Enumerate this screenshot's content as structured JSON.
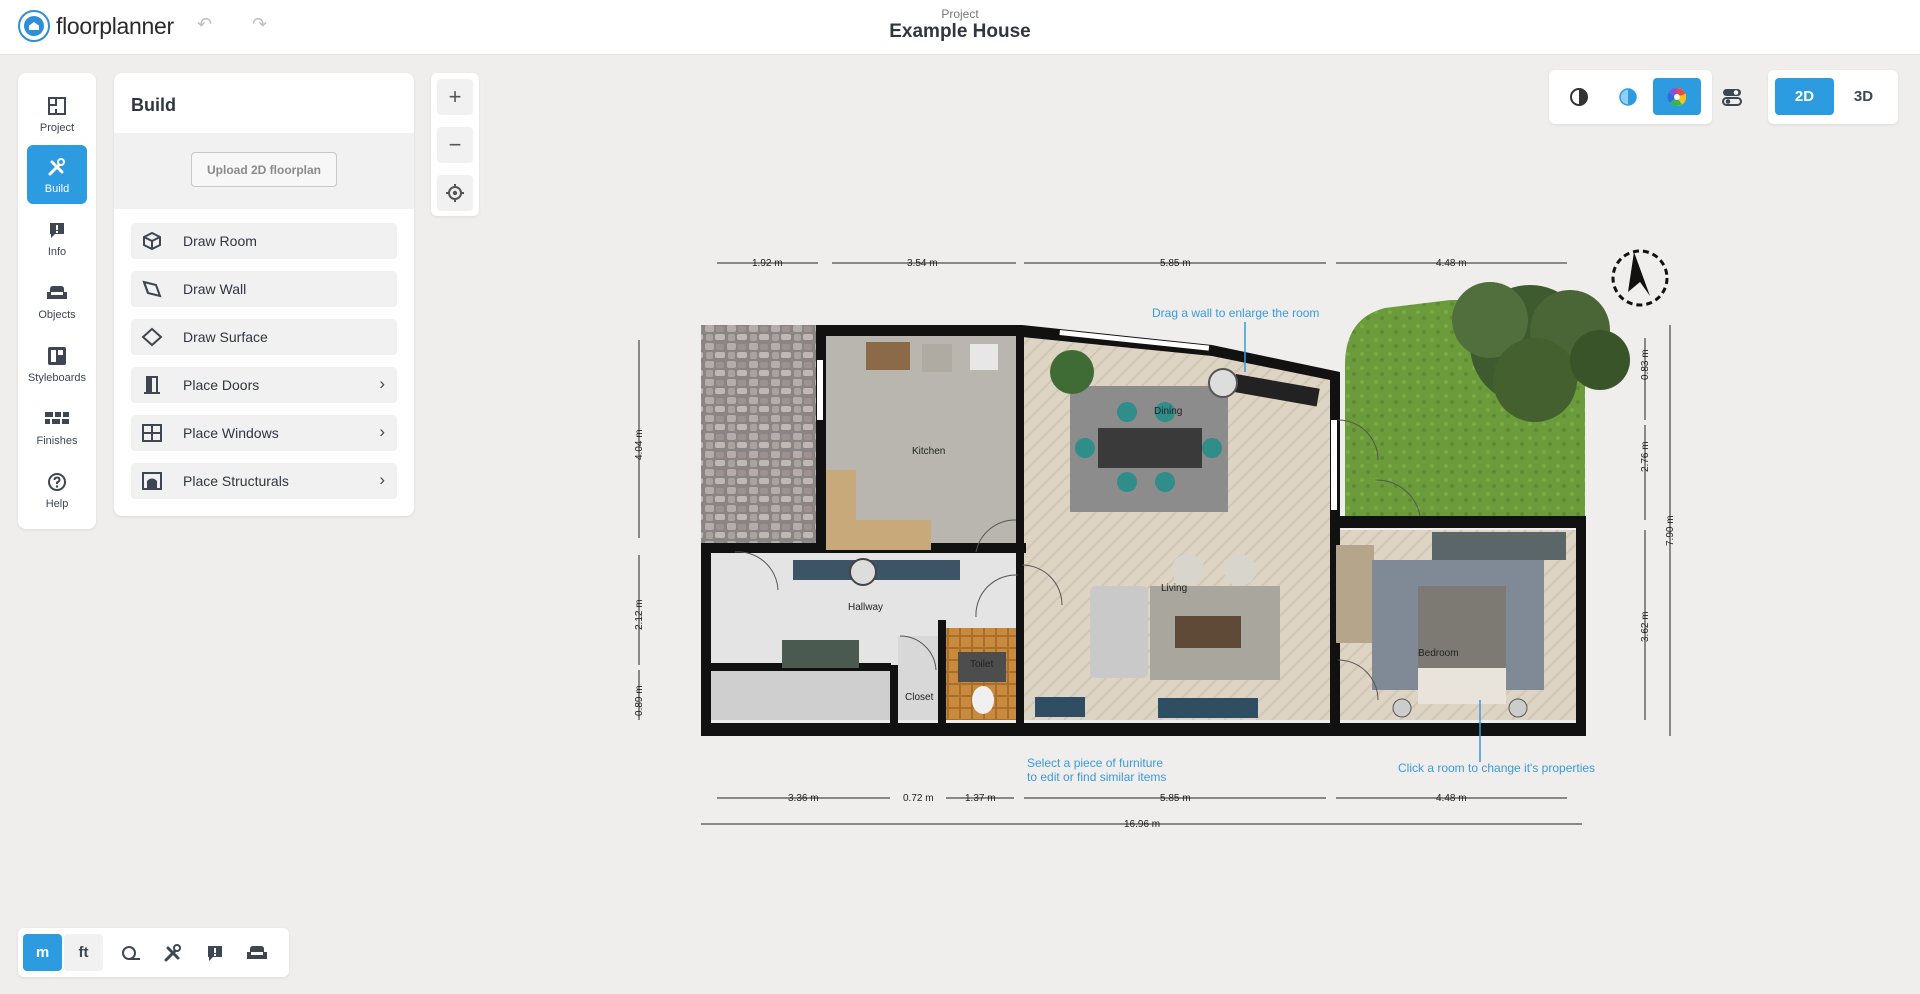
{
  "app": {
    "logo_text": "floorplanner"
  },
  "header": {
    "project_label": "Project",
    "project_title": "Example House"
  },
  "rail": [
    {
      "label": "Project",
      "icon": "floorplan-icon"
    },
    {
      "label": "Build",
      "icon": "tools-icon"
    },
    {
      "label": "Info",
      "icon": "info-bubble-icon"
    },
    {
      "label": "Objects",
      "icon": "sofa-icon"
    },
    {
      "label": "Styleboards",
      "icon": "styleboard-icon"
    },
    {
      "label": "Finishes",
      "icon": "brick-icon"
    },
    {
      "label": "Help",
      "icon": "help-icon"
    }
  ],
  "panel": {
    "title": "Build",
    "upload_label": "Upload 2D floorplan",
    "tools": [
      {
        "label": "Draw Room",
        "icon": "cube-icon",
        "submenu": false
      },
      {
        "label": "Draw Wall",
        "icon": "wall-icon",
        "submenu": false
      },
      {
        "label": "Draw Surface",
        "icon": "surface-icon",
        "submenu": false
      },
      {
        "label": "Place Doors",
        "icon": "door-icon",
        "submenu": true
      },
      {
        "label": "Place Windows",
        "icon": "window-icon",
        "submenu": true
      },
      {
        "label": "Place Structurals",
        "icon": "structural-icon",
        "submenu": true
      }
    ]
  },
  "zoom": {
    "in": "+",
    "out": "−"
  },
  "view_modes": {
    "active": "color",
    "items": [
      "contrast-icon",
      "blueprint-icon",
      "color-wheel-icon",
      "toggle-settings-icon"
    ]
  },
  "dimension_mode": {
    "options": [
      "2D",
      "3D"
    ],
    "active": "2D"
  },
  "units": {
    "options": [
      "m",
      "ft"
    ],
    "active": "m"
  },
  "plan": {
    "rooms": [
      "Kitchen",
      "Dining",
      "Living",
      "Hallway",
      "Toilet",
      "Closet",
      "Bedroom"
    ],
    "dims_top": [
      "1.92 m",
      "3.54 m",
      "5.85 m",
      "4.48 m"
    ],
    "dims_bottom": [
      "3.36 m",
      "0.72 m",
      "1.37 m",
      "5.85 m",
      "4.48 m"
    ],
    "dim_total": "16.96 m",
    "dims_left": [
      "4.04 m",
      "2.12 m",
      "0.89 m"
    ],
    "dims_right": [
      "0.83 m",
      "2.76 m",
      "3.62 m"
    ],
    "dim_right_total": "7.90 m",
    "hints": {
      "wall": "Drag a wall to enlarge the room",
      "furniture_1": "Select a piece of furniture",
      "furniture_2": "to edit or find similar items",
      "room": "Click a room to change it's properties"
    }
  }
}
